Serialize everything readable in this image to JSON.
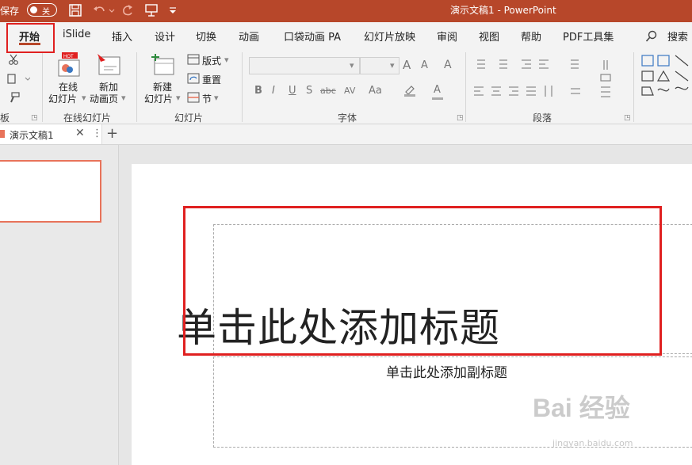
{
  "titlebar": {
    "autosave_label": "保存",
    "toggle_text": "关",
    "window_title": "演示文稿1  -  PowerPoint"
  },
  "tabs": [
    {
      "label": "开始"
    },
    {
      "label": "iSlide"
    },
    {
      "label": "插入"
    },
    {
      "label": "设计"
    },
    {
      "label": "切换"
    },
    {
      "label": "动画"
    },
    {
      "label": "口袋动画 PA"
    },
    {
      "label": "幻灯片放映"
    },
    {
      "label": "审阅"
    },
    {
      "label": "视图"
    },
    {
      "label": "帮助"
    },
    {
      "label": "PDF工具集"
    }
  ],
  "search_label": "搜索",
  "ribbon": {
    "clipboard_label": "板",
    "online": {
      "btn1_line1": "在线",
      "btn1_line2": "幻灯片",
      "btn2_line1": "新加",
      "btn2_line2": "动画页",
      "hot": "HOT",
      "group_label": "在线幻灯片"
    },
    "slides": {
      "new_line1": "新建",
      "new_line2": "幻灯片",
      "layout": "版式",
      "reset": "重置",
      "section": "节",
      "group_label": "幻灯片"
    },
    "font": {
      "grow": "A",
      "shrink": "A",
      "clear": "A",
      "bold": "B",
      "italic": "I",
      "underline": "U",
      "shadow": "S",
      "strike": "abc",
      "spacing": "AV",
      "aa": "Aa",
      "color": "A",
      "group_label": "字体"
    },
    "paragraph": {
      "group_label": "段落"
    }
  },
  "doc_tab": {
    "name": "演示文稿1",
    "close": "✕",
    "more": "⋮",
    "add": "+"
  },
  "slide": {
    "title_placeholder": "单击此处添加标题",
    "subtitle_placeholder": "单击此处添加副标题"
  },
  "watermark": {
    "brand": "Bai 经验",
    "url": "jingyan.baidu.com"
  },
  "colors": {
    "accent": "#b7472a",
    "highlight": "#e02020"
  }
}
